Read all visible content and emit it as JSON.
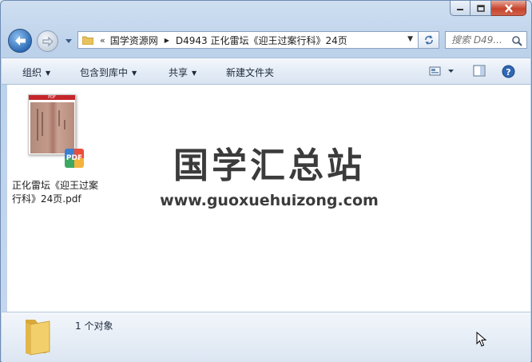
{
  "window": {
    "caption_buttons": [
      "minimize",
      "maximize",
      "close"
    ]
  },
  "address_bar": {
    "overflow_glyph": "«",
    "breadcrumbs": [
      "国学资源网",
      "D4943 正化雷坛《迎王过案行科》24页"
    ]
  },
  "search": {
    "placeholder": "搜索 D49..."
  },
  "toolbar": {
    "organize": "组织",
    "include_in_library": "包含到库中",
    "share": "共享",
    "new_folder": "新建文件夹"
  },
  "files": [
    {
      "name": "正化雷坛《迎王过案行科》24页.pdf",
      "thumb_band": "PDF",
      "badge": "PDF"
    }
  ],
  "watermark": {
    "title": "国学汇总站",
    "url": "www.guoxuehuizong.com"
  },
  "details_pane": {
    "item_count": "1 个对象"
  },
  "colors": {
    "window_frame": "#bcd1ea",
    "content_bg": "#ffffff",
    "close_button": "#c7432c",
    "watermark_text": "#3b3b3b"
  },
  "icons": [
    "back-arrow-icon",
    "forward-arrow-icon",
    "folder-icon",
    "refresh-icon",
    "search-icon",
    "view-options-icon",
    "preview-pane-icon",
    "help-icon",
    "pdf-icon",
    "cursor-icon"
  ]
}
